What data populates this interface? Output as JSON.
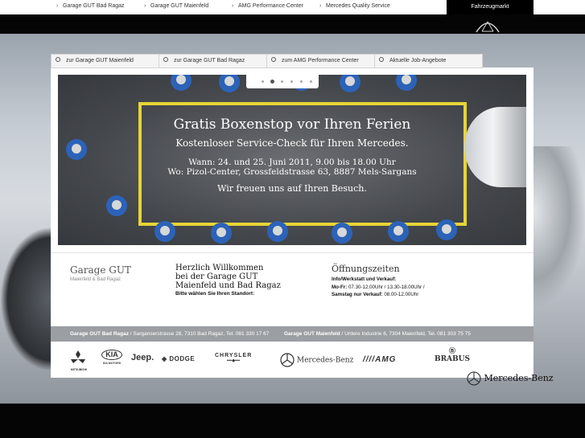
{
  "top_nav": {
    "items": [
      "Garage GUT Bad Ragaz",
      "Garage GUT Maienfeld",
      "AMG Performance Center",
      "Mercedes Quality Service"
    ],
    "fahrzeugmarkt": "Fahrzeugmarkt"
  },
  "tabs": [
    "zur Garage GUT Maienfeld",
    "zur Garage GUT Bad Ragaz",
    "zum AMG Performance Center",
    "Aktuelle Job-Angebote"
  ],
  "slider": {
    "count": 6,
    "active_index": 1
  },
  "banner": {
    "headline": "Gratis Boxenstop vor Ihren Ferien",
    "subline": "Kostenloser Service-Check für Ihren Mercedes.",
    "when": "Wann: 24. und 25. Juni 2011, 9.00 bis 18.00 Uhr",
    "where": "Wo: Pizol-Center, Grossfeldstrasse 63, 8887 Mels-Sargans",
    "closing": "Wir freuen uns auf Ihren Besuch."
  },
  "brand": {
    "name": "Garage GUT",
    "sub": "Maienfeld & Bad Ragaz"
  },
  "welcome": {
    "title_line1": "Herzlich Willkommen",
    "title_line2": "bei der Garage GUT",
    "title_line3": "Maienfeld und Bad Ragaz",
    "note": "Bitte wählen Sie Ihren Standort:"
  },
  "hours": {
    "title": "Öffnungszeiten",
    "line1": "Info/Werkstatt und Verkauf:",
    "line2_label": "Mo-Fr:",
    "line2_value": " 07.30-12.00Uhr / 13.30-18.00Uhr /",
    "line3_label": "Samstag nur Verkauf:",
    "line3_value": " 08.00-12.00Uhr"
  },
  "addresses": [
    {
      "name": "Garage GUT Bad Ragaz",
      "detail": " / Sarganserstrasse 28, 7310 Bad Ragaz, Tel. 081 330 17 67"
    },
    {
      "name": "Garage GUT Maienfeld",
      "detail": " / Untere Industrie 6, 7304 Maienfeld, Tel. 081 303 75 75"
    }
  ],
  "logos": {
    "mitsubishi": "MITSUBISHI",
    "kia": "KIA",
    "kia_sub": "KIA MOTORS",
    "jeep": "Jeep.",
    "dodge": "DODGE",
    "chrysler": "CHRYSLER",
    "mercedes": "Mercedes-Benz",
    "amg": "AMG",
    "brabus": "BRABUS"
  },
  "bg_brand": "Mercedes-Benz",
  "colors": {
    "accent_yellow": "#e7d437",
    "crew_blue": "#2c63b8",
    "address_bar": "#9b9fa3"
  }
}
